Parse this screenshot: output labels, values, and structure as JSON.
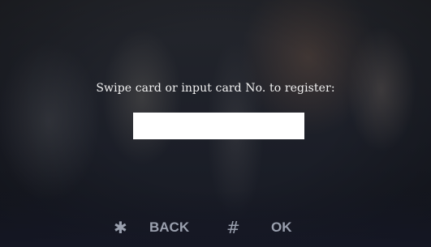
{
  "dialog": {
    "prompt": "Swipe card or input card No. to register:",
    "card_input_value": "",
    "card_input_placeholder": ""
  },
  "softkeys": {
    "back_glyph": "✱",
    "back_label": "BACK",
    "back_icon": "asterisk-icon",
    "ok_glyph": "#",
    "ok_label": "OK",
    "ok_icon": "hash-icon"
  },
  "colors": {
    "prompt_text": "#f2f2f2",
    "softkey_text": "#9aa0ae",
    "input_background": "#ffffff"
  }
}
